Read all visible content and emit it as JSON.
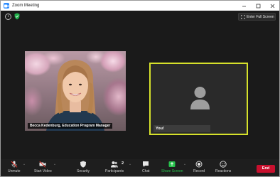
{
  "window": {
    "title": "Zoom Meeting",
    "minimize_icon": "minimize-icon",
    "maximize_icon": "maximize-icon",
    "close_icon": "close-icon"
  },
  "top_bar": {
    "info_icon": "info-icon",
    "security_icon": "shield-icon",
    "fullscreen_label": "Enter Full Screen"
  },
  "participants": [
    {
      "name": "Becca Kedenburg, Education Program Manager",
      "video_on": true,
      "active_speaker": false
    },
    {
      "name": "You!",
      "video_on": false,
      "active_speaker": true
    }
  ],
  "colors": {
    "active_border": "#d6e12b",
    "share_green": "#27c24c",
    "end_red": "#c8102e"
  },
  "toolbar": {
    "unmute_label": "Unmute",
    "start_video_label": "Start Video",
    "security_label": "Security",
    "participants_label": "Participants",
    "participants_count": "2",
    "chat_label": "Chat",
    "share_label": "Share Screen",
    "record_label": "Record",
    "reactions_label": "Reactions",
    "end_label": "End"
  }
}
